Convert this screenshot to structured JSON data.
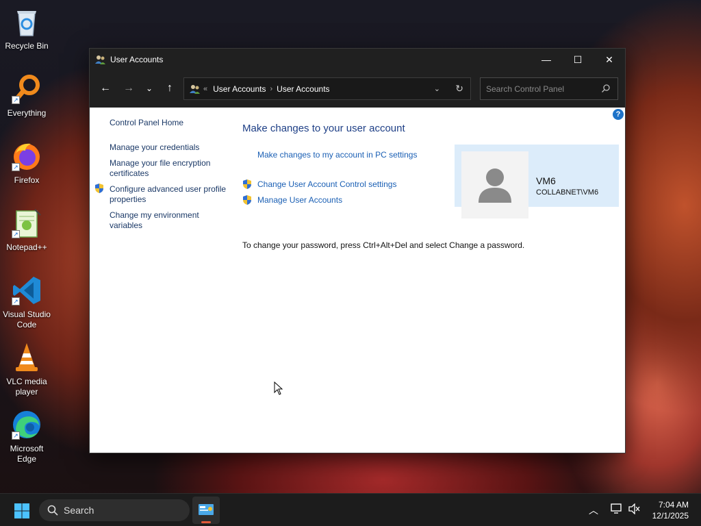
{
  "desktop": {
    "icons": [
      {
        "label": "Recycle Bin",
        "icon": "recycle-bin-icon"
      },
      {
        "label": "Everything",
        "icon": "everything-search-icon"
      },
      {
        "label": "Firefox",
        "icon": "firefox-icon"
      },
      {
        "label": "Notepad++",
        "icon": "notepad-plus-plus-icon"
      },
      {
        "label": "Visual Studio Code",
        "icon": "vscode-icon"
      },
      {
        "label": "VLC media player",
        "icon": "vlc-icon"
      },
      {
        "label": "Microsoft Edge",
        "icon": "edge-icon"
      }
    ]
  },
  "window": {
    "title": "User Accounts",
    "controls": {
      "minimize": "—",
      "maximize": "☐",
      "close": "✕"
    },
    "address": {
      "chevrons": "«",
      "crumbs": [
        "User Accounts",
        "User Accounts"
      ],
      "separator": "›"
    },
    "search_placeholder": "Search Control Panel",
    "help_label": "?"
  },
  "left_pane": {
    "home": "Control Panel Home",
    "links": [
      "Manage your credentials",
      "Manage your file encryption certificates",
      "Configure advanced user profile properties",
      "Change my environment variables"
    ]
  },
  "main": {
    "heading": "Make changes to your user account",
    "pc_settings_link": "Make changes to my account in PC settings",
    "uac_link": "Change User Account Control settings",
    "manage_link": "Manage User Accounts",
    "password_hint": "To change your password, press Ctrl+Alt+Del and select Change a password."
  },
  "account": {
    "name": "VM6",
    "domain": "COLLABNET\\VM6"
  },
  "taskbar": {
    "search_label": "Search",
    "time": "7:04 AM",
    "date": "12/1/2025"
  },
  "colors": {
    "link": "#1a5fb4",
    "heading": "#1e3f86",
    "card_bg": "#dcecfa",
    "accent_indicator": "#e05a3a"
  }
}
